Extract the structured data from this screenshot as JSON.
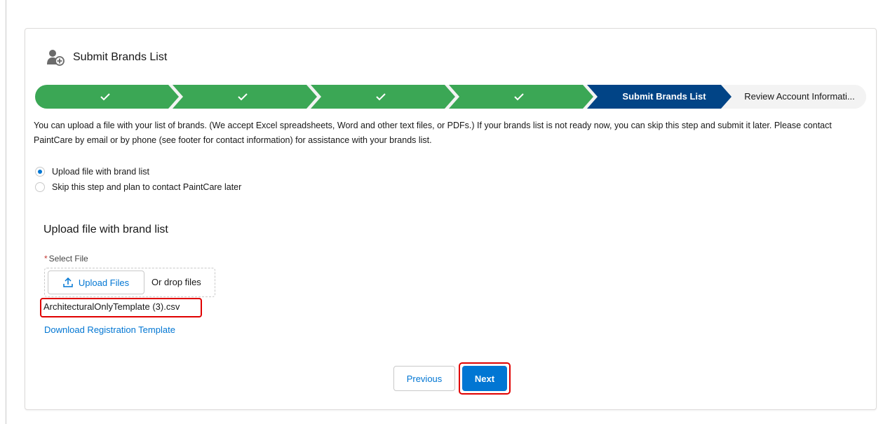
{
  "header": {
    "title": "Submit Brands List",
    "icon": "user-add-icon"
  },
  "path": {
    "steps": [
      {
        "status": "complete",
        "icon": "checkmark-icon"
      },
      {
        "status": "complete",
        "icon": "checkmark-icon"
      },
      {
        "status": "complete",
        "icon": "checkmark-icon"
      },
      {
        "status": "complete",
        "icon": "checkmark-icon"
      },
      {
        "status": "current",
        "label": "Submit Brands List"
      },
      {
        "status": "incomplete",
        "label": "Review Account Informati..."
      }
    ],
    "colors": {
      "complete": "#3ba755",
      "current": "#014486",
      "incomplete": "#f3f3f3"
    }
  },
  "intro": "You can upload a file with your list of brands. (We accept Excel spreadsheets, Word and other text files, or PDFs.) If your brands list is not ready now, you can skip this step and submit it later. Please contact PaintCare by email or by phone (see footer for contact information) for assistance with your brands list.",
  "options": [
    {
      "label": "Upload file with brand list",
      "selected": true
    },
    {
      "label": "Skip this step and plan to contact PaintCare later",
      "selected": false
    }
  ],
  "upload": {
    "section_title": "Upload file with brand list",
    "required_marker": "*",
    "field_label": "Select File",
    "button_label": "Upload Files",
    "drop_text": "Or drop files",
    "filename": "ArchitecturalOnlyTemplate (3).csv",
    "download_link": "Download Registration Template"
  },
  "footer": {
    "previous_label": "Previous",
    "next_label": "Next"
  },
  "colors": {
    "brand": "#0176d3",
    "highlight": "#e00000"
  }
}
